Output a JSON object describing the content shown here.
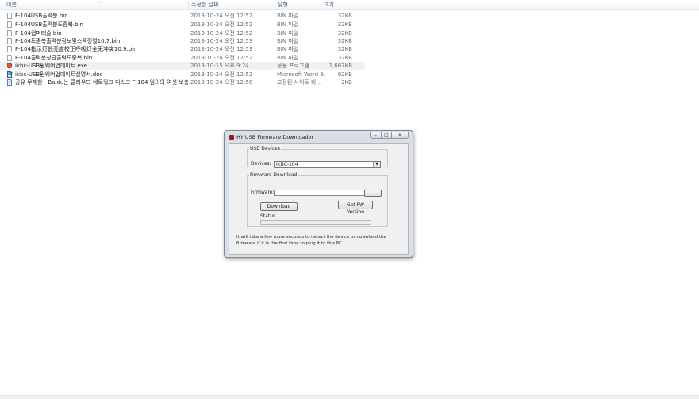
{
  "columns": {
    "name": "이름",
    "date": "수정한 날짜",
    "type": "유형",
    "size": "크기"
  },
  "files": [
    {
      "name": "F-104USB출력분.bin",
      "date": "2013-10-24 오전 12:52",
      "type": "BIN 파일",
      "size": "32KB",
      "icon": "file-icon"
    },
    {
      "name": "F-104USB출력분도중복.bin",
      "date": "2013-10-24 오전 12:52",
      "type": "BIN 파일",
      "size": "32KB",
      "icon": "file-icon"
    },
    {
      "name": "F-104랩퍼태슬.bin",
      "date": "2013-10-24 오전 12:52",
      "type": "BIN 파일",
      "size": "32KB",
      "icon": "file-icon"
    },
    {
      "name": "F-104도중복출력분정보및스펙정렬10.7.bin",
      "date": "2013-10-24 오전 12:53",
      "type": "BIN 파일",
      "size": "32KB",
      "icon": "file-icon"
    },
    {
      "name": "F-104指示灯低亮度校正呼吸灯全无冲突10.9.bin",
      "date": "2013-10-24 오전 12:53",
      "type": "BIN 파일",
      "size": "32KB",
      "icon": "file-icon"
    },
    {
      "name": "F-104출력분상급출력도중복.bin",
      "date": "2013-10-24 오전 12:52",
      "type": "BIN 파일",
      "size": "32KB",
      "icon": "file-icon"
    },
    {
      "name": "ikbc-USB펌웨어업데이트.exe",
      "date": "2013-10-15 오후 9:24",
      "type": "응용 프로그램",
      "size": "1,667KB",
      "icon": "exe-icon",
      "selected": true
    },
    {
      "name": "ikbc-USB펌웨어업데이트설명서.doc",
      "date": "2013-10-24 오전 12:52",
      "type": "Microsoft Word 9...",
      "size": "92KB",
      "icon": "word-doc-icon"
    },
    {
      "name": "공유 무제한 - Baidu는 클라우드 네트워크 디스크 F-104 임의의 여섯 보충 조...",
      "date": "2013-10-24 오전 12:56",
      "type": "고정된 사이트 바...",
      "size": "2KB",
      "icon": "shortcut-icon"
    }
  ],
  "dialog": {
    "title": "HY USB Firmware Downloader",
    "usb_group_label": "USB Devices",
    "devices_label": "Devices:",
    "devices_value": "IKBC-104",
    "firmware_group_label": "Firmware Download",
    "firmware_label": "Firmware:",
    "firmware_value": "",
    "browse_label": "...",
    "download_label": "Download",
    "get_fw_label": "Get FW Version",
    "status_label": "Status",
    "progress_percent": 0,
    "note": "It will take a few more seconds to detect the device or download the firmware if it is the first time to plug it to this PC.",
    "title_buttons": {
      "minimize": "–",
      "maximize": "□",
      "close": "✕"
    }
  }
}
